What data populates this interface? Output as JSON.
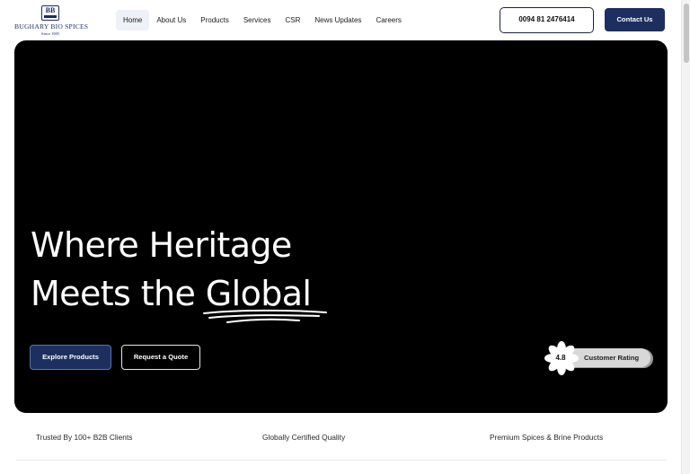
{
  "brand": {
    "logo_mark": "BB",
    "name": "BUGHARY BIO SPICES",
    "since": "Since 1985"
  },
  "nav": {
    "items": [
      {
        "label": "Home",
        "active": true
      },
      {
        "label": "About Us",
        "active": false
      },
      {
        "label": "Products",
        "active": false
      },
      {
        "label": "Services",
        "active": false
      },
      {
        "label": "CSR",
        "active": false
      },
      {
        "label": "News Updates",
        "active": false
      },
      {
        "label": "Careers",
        "active": false
      }
    ],
    "phone_label": "0094 81 2476414",
    "contact_label": "Contact Us"
  },
  "hero": {
    "title_line1": "Where Heritage",
    "title_line2_prefix": "Meets the ",
    "title_highlight": "Global",
    "explore_label": "Explore Products",
    "quote_label": "Request a Quote",
    "rating_value": "4.8",
    "rating_label": "Customer Rating"
  },
  "features": {
    "items": [
      "Trusted By 100+ B2B Clients",
      "Globally Certified Quality",
      "Premium Spices & Brine Products"
    ]
  },
  "colors": {
    "brand_navy": "#1c2f5f",
    "hero_background": "#000000"
  },
  "icons": {
    "rating_badge": "star-burst-icon"
  }
}
